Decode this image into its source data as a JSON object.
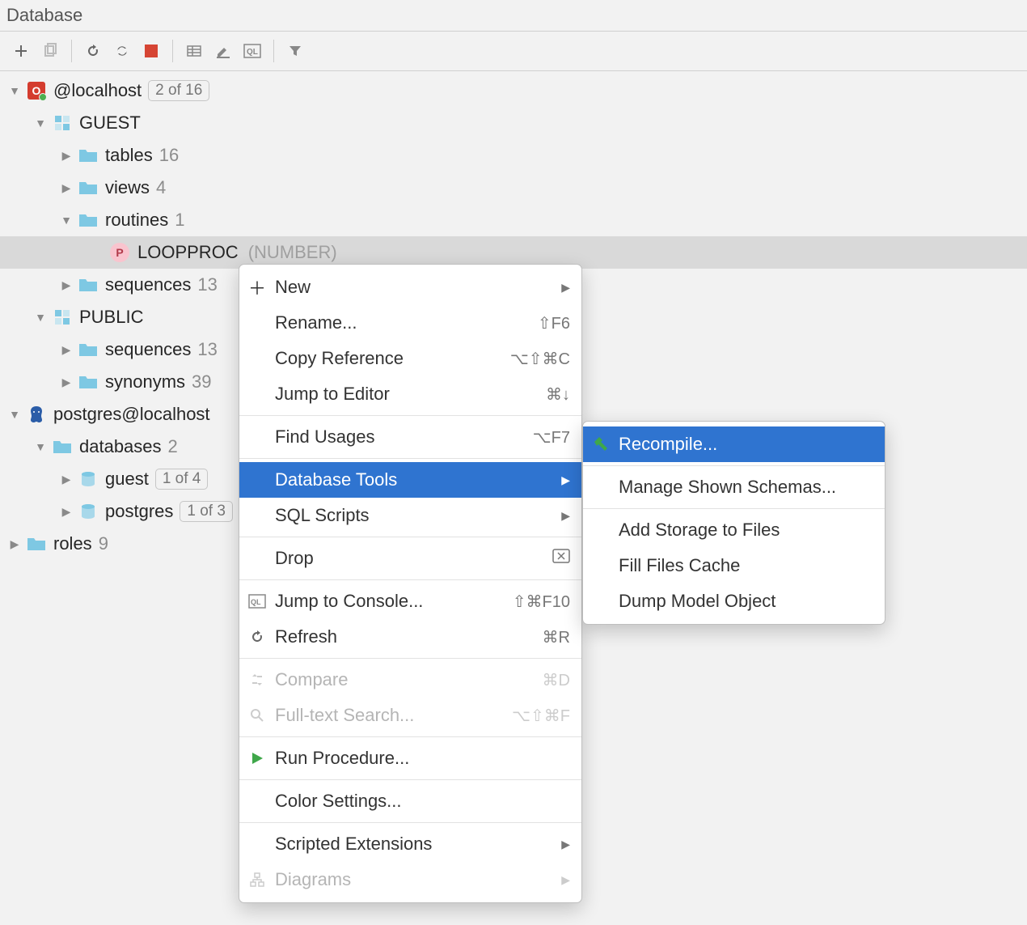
{
  "panel_title": "Database",
  "tree": {
    "ds1": {
      "name": "@localhost",
      "badge": "2 of 16"
    },
    "guest_schema": "GUEST",
    "tables": {
      "label": "tables",
      "count": "16"
    },
    "views": {
      "label": "views",
      "count": "4"
    },
    "routines": {
      "label": "routines",
      "count": "1"
    },
    "proc": {
      "name": "LOOPPROC",
      "rtype": "(NUMBER)"
    },
    "sequences1": {
      "label": "sequences",
      "count": "13"
    },
    "public_schema": "PUBLIC",
    "sequences2": {
      "label": "sequences",
      "count": "13"
    },
    "synonyms": {
      "label": "synonyms",
      "count": "39"
    },
    "ds2": {
      "name": "postgres@localhost"
    },
    "databases": {
      "label": "databases",
      "count": "2"
    },
    "db_guest": {
      "name": "guest",
      "badge": "1 of 4"
    },
    "db_postgres": {
      "name": "postgres",
      "badge": "1 of 3"
    },
    "roles": {
      "label": "roles",
      "count": "9"
    }
  },
  "menu1": {
    "new": "New",
    "rename": "Rename...",
    "rename_sc": "⇧F6",
    "copyref": "Copy Reference",
    "copyref_sc": "⌥⇧⌘C",
    "jump": "Jump to Editor",
    "jump_sc": "⌘↓",
    "find": "Find Usages",
    "find_sc": "⌥F7",
    "dbtools": "Database Tools",
    "sqlscripts": "SQL Scripts",
    "drop": "Drop",
    "console": "Jump to Console...",
    "console_sc": "⇧⌘F10",
    "refresh": "Refresh",
    "refresh_sc": "⌘R",
    "compare": "Compare",
    "compare_sc": "⌘D",
    "fts": "Full-text Search...",
    "fts_sc": "⌥⇧⌘F",
    "runproc": "Run Procedure...",
    "color": "Color Settings...",
    "scripted": "Scripted Extensions",
    "diagrams": "Diagrams"
  },
  "menu2": {
    "recompile": "Recompile...",
    "manage": "Manage Shown Schemas...",
    "addstorage": "Add Storage to Files",
    "fillcache": "Fill Files Cache",
    "dumpmodel": "Dump Model Object"
  }
}
